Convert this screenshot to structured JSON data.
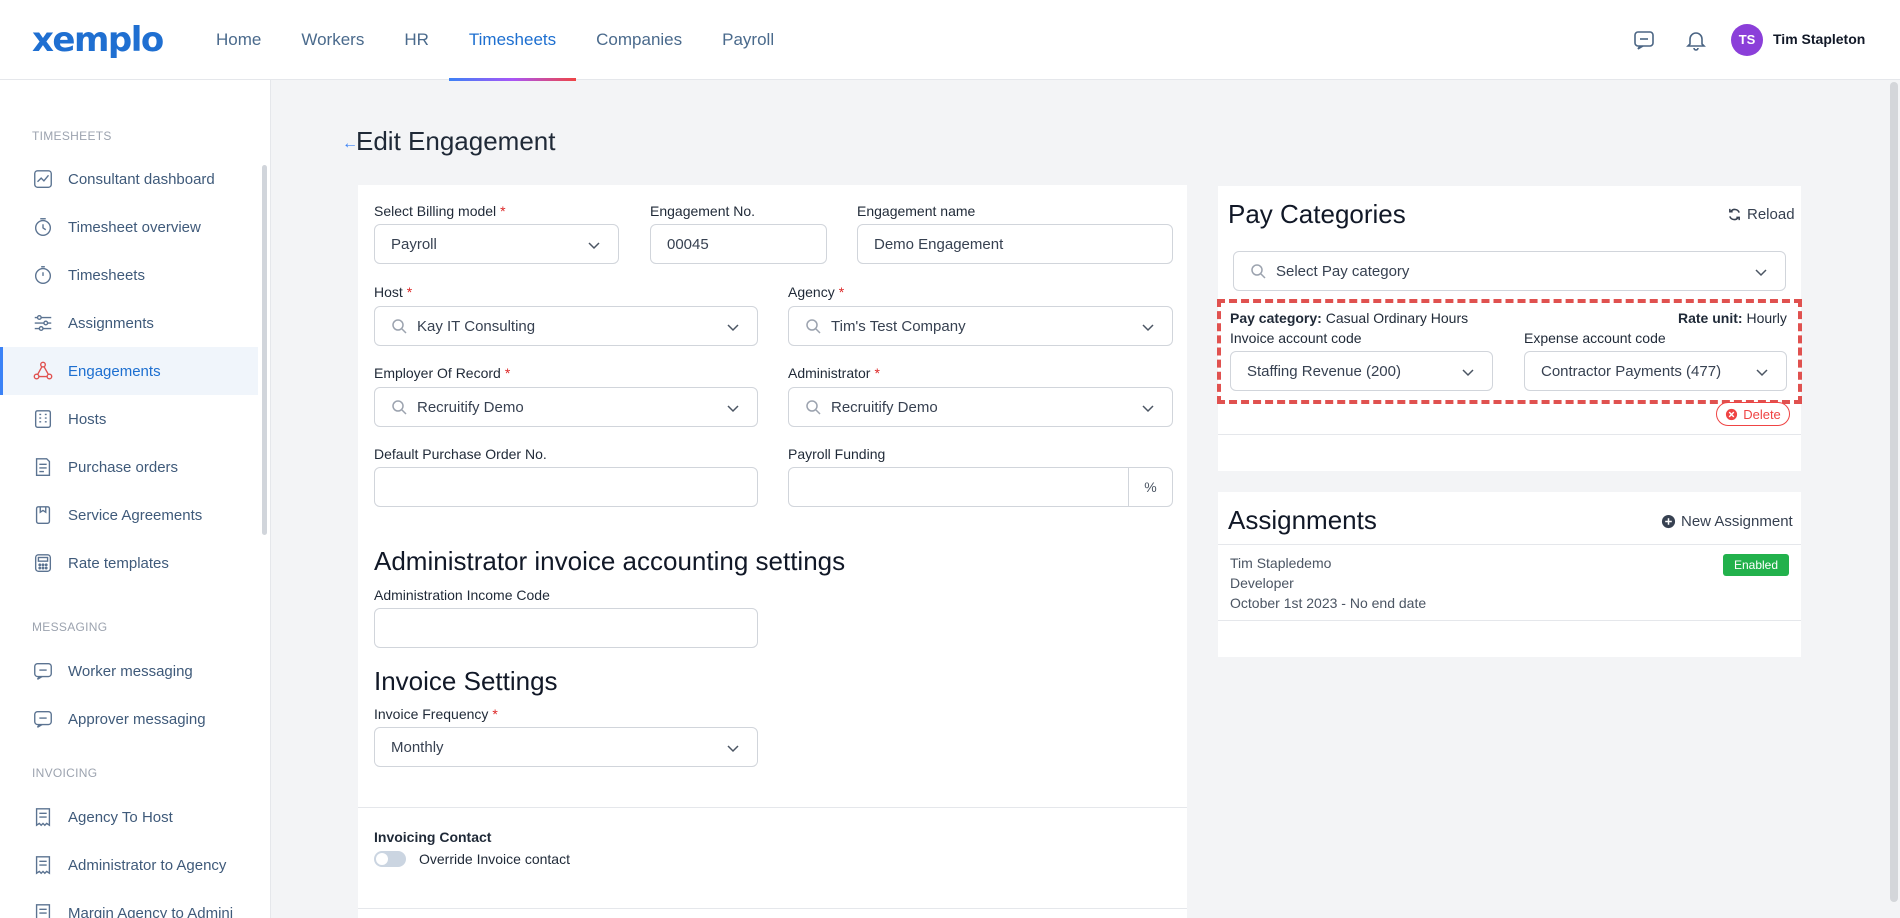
{
  "brand": {
    "logo": "xemplo"
  },
  "nav": {
    "items": [
      "Home",
      "Workers",
      "HR",
      "Timesheets",
      "Companies",
      "Payroll"
    ],
    "active": "Timesheets"
  },
  "user": {
    "initials": "TS",
    "name": "Tim Stapleton"
  },
  "sidebar": {
    "sections": [
      {
        "title": "TIMESHEETS",
        "items": [
          "Consultant dashboard",
          "Timesheet overview",
          "Timesheets",
          "Assignments",
          "Engagements",
          "Hosts",
          "Purchase orders",
          "Service Agreements",
          "Rate templates"
        ]
      },
      {
        "title": "MESSAGING",
        "items": [
          "Worker messaging",
          "Approver messaging"
        ]
      },
      {
        "title": "INVOICING",
        "items": [
          "Agency To Host",
          "Administrator to Agency",
          "Margin Agency to Admini"
        ]
      }
    ],
    "active": "Engagements"
  },
  "page": {
    "title": "Edit Engagement",
    "back": "←"
  },
  "form": {
    "billing_model": {
      "label": "Select Billing model",
      "value": "Payroll"
    },
    "engagement_no": {
      "label": "Engagement No.",
      "value": "00045"
    },
    "engagement_name": {
      "label": "Engagement name",
      "value": "Demo Engagement"
    },
    "host": {
      "label": "Host",
      "value": "Kay IT Consulting"
    },
    "agency": {
      "label": "Agency",
      "value": "Tim's Test Company"
    },
    "employer_of_record": {
      "label": "Employer Of Record",
      "value": "Recruitify Demo"
    },
    "administrator": {
      "label": "Administrator",
      "value": "Recruitify Demo"
    },
    "default_po": {
      "label": "Default Purchase Order No.",
      "value": ""
    },
    "payroll_funding": {
      "label": "Payroll Funding",
      "value": "",
      "unit": "%"
    },
    "admin_section_title": "Administrator invoice accounting settings",
    "admin_income_code": {
      "label": "Administration Income Code",
      "value": ""
    },
    "invoice_section_title": "Invoice Settings",
    "invoice_frequency": {
      "label": "Invoice Frequency",
      "value": "Monthly"
    },
    "invoicing_contact": {
      "title": "Invoicing Contact",
      "toggle_label": "Override Invoice contact",
      "enabled": false
    },
    "required_mark": "*"
  },
  "pay_categories": {
    "title": "Pay Categories",
    "reload_label": "Reload",
    "select_placeholder": "Select Pay category",
    "item": {
      "category_label": "Pay category:",
      "category_value": "Casual Ordinary Hours",
      "rate_unit_label": "Rate unit:",
      "rate_unit_value": "Hourly",
      "invoice_code_label": "Invoice account code",
      "invoice_code_value": "Staffing Revenue (200)",
      "expense_code_label": "Expense account code",
      "expense_code_value": "Contractor Payments (477)",
      "delete_label": "Delete"
    }
  },
  "assignments": {
    "title": "Assignments",
    "new_label": "New Assignment",
    "items": [
      {
        "name": "Tim Stapledemo",
        "role": "Developer",
        "dates": "October 1st 2023 - No end date",
        "status": "Enabled"
      }
    ]
  },
  "colors": {
    "accent": "#1d6fd0",
    "required": "#dc2626",
    "highlight_dash": "#e0514f",
    "enabled": "#22b14c",
    "avatar": "#8b3fd9"
  }
}
